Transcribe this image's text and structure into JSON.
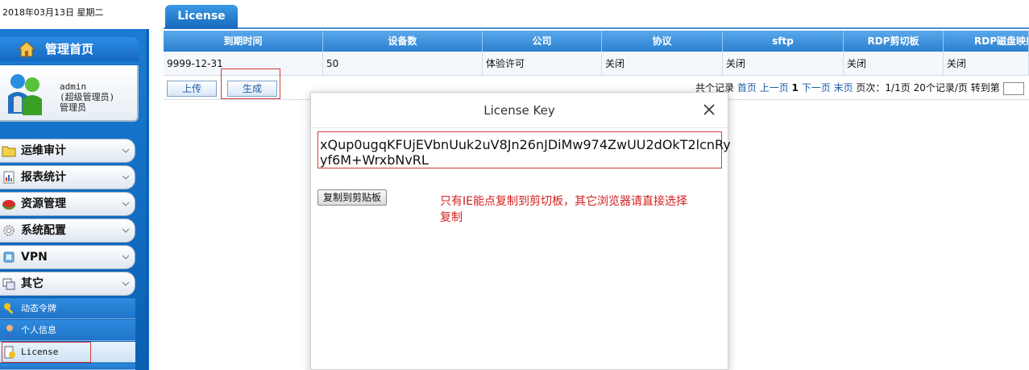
{
  "date_bar": "2018年03月13日 星期二",
  "sidebar": {
    "home_label": "管理首页",
    "user": {
      "name": "admin",
      "role": "(超级管理员)",
      "group": "管理员"
    },
    "menus": [
      {
        "label": "运维审计",
        "icon": "folder-icon"
      },
      {
        "label": "报表统计",
        "icon": "report-icon"
      },
      {
        "label": "资源管理",
        "icon": "resource-icon"
      },
      {
        "label": "系统配置",
        "icon": "settings-icon"
      },
      {
        "label": "VPN",
        "icon": "vpn-icon"
      },
      {
        "label": "其它",
        "icon": "other-icon"
      }
    ],
    "sub_items": [
      {
        "label": "动态令牌",
        "icon": "key-icon"
      },
      {
        "label": "个人信息",
        "icon": "person-icon"
      },
      {
        "label": "License",
        "icon": "license-icon"
      }
    ]
  },
  "tab": {
    "label": "License"
  },
  "table": {
    "columns": [
      "到期时间",
      "设备数",
      "公司",
      "协议",
      "sftp",
      "RDP剪切板",
      "RDP磁盘映射"
    ],
    "row": [
      "9999-12-31",
      "50",
      "体验许可",
      "关闭",
      "关闭",
      "关闭",
      "关闭"
    ]
  },
  "actions": {
    "upload_label": "上传",
    "generate_label": "生成"
  },
  "pager": {
    "total": "共个记录",
    "first": "首页",
    "prev": "上一页",
    "current": "1",
    "next": "下一页",
    "last": "末页",
    "page_info": "页次：1/1页",
    "per_page": "20个记录/页",
    "goto": "转到第"
  },
  "dialog": {
    "title": "License Key",
    "key_line1": "xQup0ugqKFUjEVbnUuk2uV8Jn26nJDiMw974ZwUU2dOkT2lcnRy",
    "key_line2": "yf6M+WrxbNvRL",
    "copy_button": "复制到剪贴板",
    "hint_line1": "只有IE能点复制到剪切板，其它浏览器请直接选择",
    "hint_line2": "复制"
  },
  "colors": {
    "accent": "#1b7bd3",
    "highlight_border": "#d23a3a",
    "hint_text": "#d42020"
  }
}
